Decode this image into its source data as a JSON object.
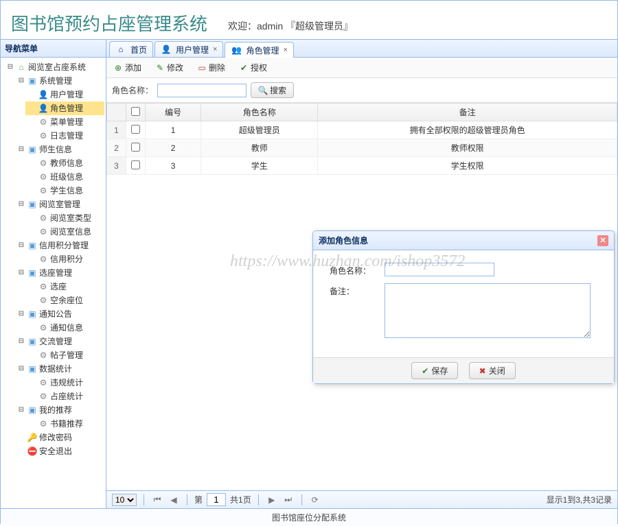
{
  "header": {
    "title": "图书馆预约占座管理系统",
    "welcome_prefix": "欢迎：",
    "user": "admin",
    "role_bracket": "『超级管理员』"
  },
  "sidebar": {
    "title": "导航菜单",
    "root": "阅览室占座系统",
    "groups": [
      {
        "label": "系统管理",
        "items": [
          "用户管理",
          "角色管理",
          "菜单管理",
          "日志管理"
        ]
      },
      {
        "label": "师生信息",
        "items": [
          "教师信息",
          "班级信息",
          "学生信息"
        ]
      },
      {
        "label": "阅览室管理",
        "items": [
          "阅览室类型",
          "阅览室信息"
        ]
      },
      {
        "label": "信用积分管理",
        "items": [
          "信用积分"
        ]
      },
      {
        "label": "选座管理",
        "items": [
          "选座",
          "空余座位"
        ]
      },
      {
        "label": "通知公告",
        "items": [
          "通知信息"
        ]
      },
      {
        "label": "交流管理",
        "items": [
          "帖子管理"
        ]
      },
      {
        "label": "数据统计",
        "items": [
          "违规统计",
          "占座统计"
        ]
      },
      {
        "label": "我的推荐",
        "items": [
          "书籍推荐"
        ]
      }
    ],
    "change_pwd": "修改密码",
    "exit": "安全退出"
  },
  "tabs": [
    {
      "label": "首页",
      "icon": "home",
      "closable": false
    },
    {
      "label": "用户管理",
      "icon": "user",
      "closable": true
    },
    {
      "label": "角色管理",
      "icon": "role",
      "closable": true,
      "active": true
    }
  ],
  "toolbar": {
    "add": "添加",
    "edit": "修改",
    "delete": "删除",
    "auth": "授权"
  },
  "search": {
    "label": "角色名称：",
    "button": "搜索"
  },
  "grid": {
    "headers": [
      "编号",
      "角色名称",
      "备注"
    ],
    "rows": [
      {
        "num": "1",
        "id": "1",
        "name": "超级管理员",
        "remark": "拥有全部权限的超级管理员角色"
      },
      {
        "num": "2",
        "id": "2",
        "name": "教师",
        "remark": "教师权限"
      },
      {
        "num": "3",
        "id": "3",
        "name": "学生",
        "remark": "学生权限"
      }
    ]
  },
  "pager": {
    "page_size": "10",
    "page_label_prefix": "第",
    "page_value": "1",
    "page_total": "共1页",
    "info": "显示1到3,共3记录"
  },
  "dialog": {
    "title": "添加角色信息",
    "field_name": "角色名称：",
    "field_remark": "备注：",
    "save": "保存",
    "close": "关闭"
  },
  "footer": "图书馆座位分配系统",
  "watermark": "https://www.huzhan.com/ishop3572"
}
